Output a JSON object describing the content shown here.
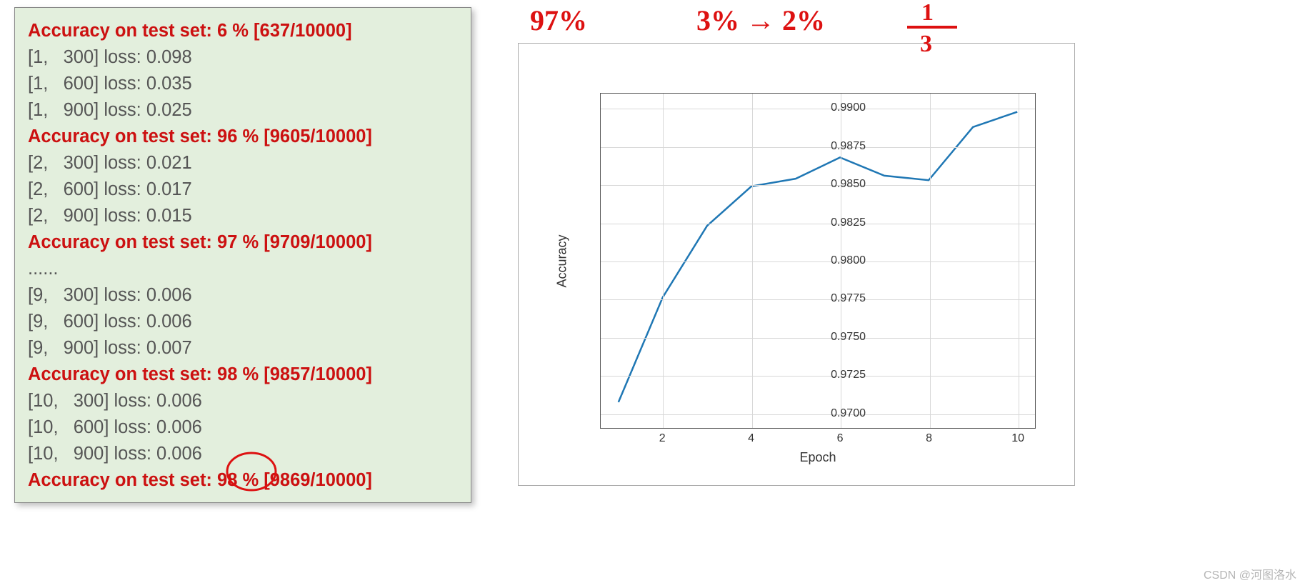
{
  "console": {
    "lines": [
      {
        "type": "acc",
        "text": "Accuracy on test set: 6 % [637/10000]"
      },
      {
        "type": "loss",
        "text": "[1,   300] loss: 0.098"
      },
      {
        "type": "loss",
        "text": "[1,   600] loss: 0.035"
      },
      {
        "type": "loss",
        "text": "[1,   900] loss: 0.025"
      },
      {
        "type": "acc",
        "text": "Accuracy on test set: 96 % [9605/10000]"
      },
      {
        "type": "loss",
        "text": "[2,   300] loss: 0.021"
      },
      {
        "type": "loss",
        "text": "[2,   600] loss: 0.017"
      },
      {
        "type": "loss",
        "text": "[2,   900] loss: 0.015"
      },
      {
        "type": "acc",
        "text": "Accuracy on test set: 97 % [9709/10000]"
      },
      {
        "type": "loss",
        "text": "......"
      },
      {
        "type": "loss",
        "text": "[9,   300] loss: 0.006"
      },
      {
        "type": "loss",
        "text": "[9,   600] loss: 0.006"
      },
      {
        "type": "loss",
        "text": "[9,   900] loss: 0.007"
      },
      {
        "type": "acc",
        "text": "Accuracy on test set: 98 % [9857/10000]"
      },
      {
        "type": "loss",
        "text": "[10,   300] loss: 0.006"
      },
      {
        "type": "loss",
        "text": "[10,   600] loss: 0.006"
      },
      {
        "type": "loss",
        "text": "[10,   900] loss: 0.006"
      },
      {
        "type": "acc",
        "text": "Accuracy on test set: 98 % [9869/10000]"
      }
    ]
  },
  "chart_data": {
    "type": "line",
    "xlabel": "Epoch",
    "ylabel": "Accuracy",
    "x": [
      1,
      2,
      3,
      4,
      5,
      6,
      7,
      8,
      9,
      10
    ],
    "values": [
      0.9707,
      0.9776,
      0.9823,
      0.9849,
      0.9854,
      0.9868,
      0.9856,
      0.9853,
      0.9888,
      0.9898
    ],
    "xticks": [
      2,
      4,
      6,
      8,
      10
    ],
    "yticks": [
      0.97,
      0.9725,
      0.975,
      0.9775,
      0.98,
      0.9825,
      0.985,
      0.9875,
      0.99
    ],
    "xlim": [
      0.6,
      10.4
    ],
    "ylim": [
      0.969,
      0.991
    ]
  },
  "annotations": {
    "hw1": "97%",
    "hw2": "3% → 2%",
    "hw3": "1/3",
    "circle_target": "98 %"
  },
  "watermark": "CSDN @河图洛水"
}
